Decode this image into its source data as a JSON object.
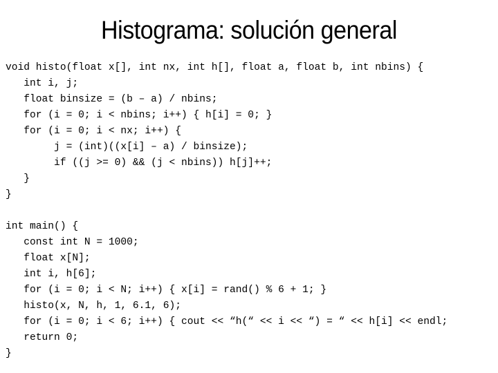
{
  "slide": {
    "title": "Histograma: solución general",
    "code_lines": [
      "void histo(float x[], int nx, int h[], float a, float b, int nbins) {",
      "   int i, j;",
      "   float binsize = (b – a) / nbins;",
      "   for (i = 0; i < nbins; i++) { h[i] = 0; }",
      "   for (i = 0; i < nx; i++) {",
      "        j = (int)((x[i] – a) / binsize);",
      "        if ((j >= 0) && (j < nbins)) h[j]++;",
      "   }",
      "}",
      "",
      "int main() {",
      "   const int N = 1000;",
      "   float x[N];",
      "   int i, h[6];",
      "   for (i = 0; i < N; i++) { x[i] = rand() % 6 + 1; }",
      "   histo(x, N, h, 1, 6.1, 6);",
      "   for (i = 0; i < 6; i++) { cout << “h(“ << i << “) = “ << h[i] << endl;",
      "   return 0;",
      "}"
    ]
  }
}
